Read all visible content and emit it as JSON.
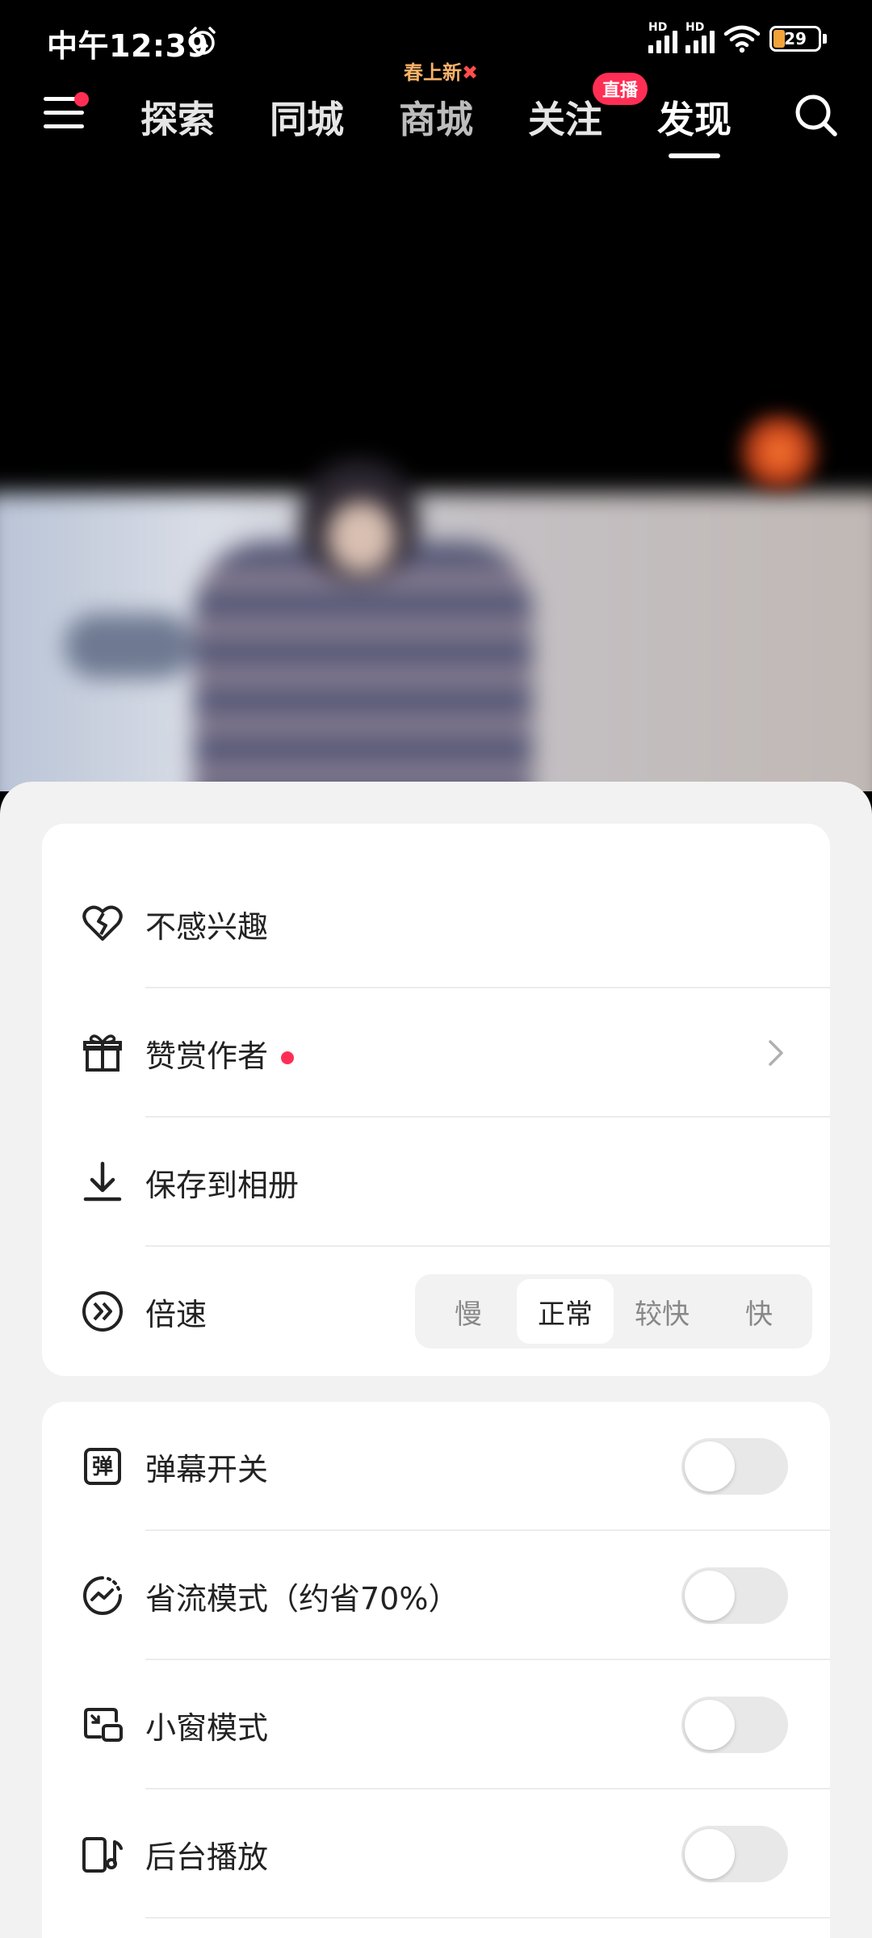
{
  "status_bar": {
    "time": "中午12:39",
    "signal_label": "HD",
    "battery": "29"
  },
  "nav": {
    "tabs": [
      {
        "label": "探索"
      },
      {
        "label": "同城"
      },
      {
        "label": "商城",
        "note": "春上新"
      },
      {
        "label": "关注",
        "badge": "直播"
      },
      {
        "label": "发现",
        "active": true
      }
    ]
  },
  "menu": {
    "group1": [
      {
        "label": "不感兴趣",
        "icon": "broken-heart-icon"
      },
      {
        "label": "赞赏作者",
        "icon": "gift-icon",
        "has_dot": true
      },
      {
        "label": "保存到相册",
        "icon": "download-icon"
      },
      {
        "label": "倍速",
        "icon": "speed-icon"
      }
    ],
    "speed_options": [
      "慢",
      "正常",
      "较快",
      "快"
    ],
    "speed_selected": "正常",
    "group2": [
      {
        "label": "弹幕开关",
        "icon": "danmaku-icon",
        "on": false
      },
      {
        "label": "省流模式（约省70%）",
        "icon": "data-saver-icon",
        "on": false
      },
      {
        "label": "小窗模式",
        "icon": "pip-icon",
        "on": false
      },
      {
        "label": "后台播放",
        "icon": "background-play-icon",
        "on": false
      }
    ],
    "danmaku_glyph": "弹"
  },
  "colors": {
    "accent": "#ff2e55",
    "note": "#f7b26a"
  }
}
